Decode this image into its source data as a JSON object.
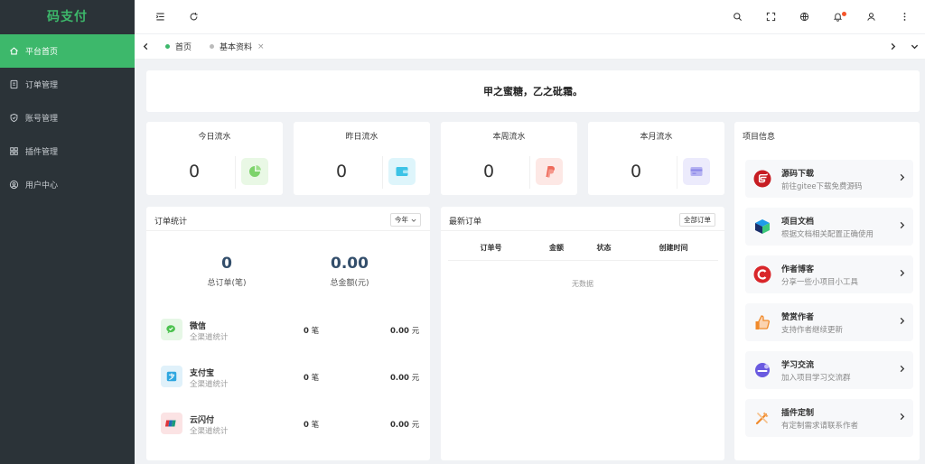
{
  "app": {
    "logo": "码支付"
  },
  "sidebar": {
    "items": [
      {
        "label": "平台首页",
        "icon": "home-icon"
      },
      {
        "label": "订单管理",
        "icon": "order-icon"
      },
      {
        "label": "账号管理",
        "icon": "shield-icon"
      },
      {
        "label": "插件管理",
        "icon": "grid-icon"
      },
      {
        "label": "用户中心",
        "icon": "user-circle-icon"
      }
    ]
  },
  "header": {
    "icons": [
      "menu-fold-icon",
      "refresh-icon",
      "search-icon",
      "fullscreen-icon",
      "globe-icon",
      "bell-icon",
      "user-icon",
      "more-icon"
    ]
  },
  "tabs": [
    {
      "label": "首页",
      "active": true
    },
    {
      "label": "基本资料",
      "active": false,
      "close": "×"
    }
  ],
  "banner": {
    "text": "甲之蜜糖，乙之砒霜。"
  },
  "stats": [
    {
      "title": "今日流水",
      "value": "0",
      "color": "#7dd36b",
      "bg": "#e9f8e5",
      "icon": "pie-chart-icon"
    },
    {
      "title": "昨日流水",
      "value": "0",
      "color": "#3cc3e6",
      "bg": "#def5fb",
      "icon": "wallet-icon"
    },
    {
      "title": "本周流水",
      "value": "0",
      "color": "#ef6a5a",
      "bg": "#fde8e5",
      "icon": "paypal-icon"
    },
    {
      "title": "本月流水",
      "value": "0",
      "color": "#8a86e8",
      "bg": "#ecebfc",
      "icon": "card-icon"
    }
  ],
  "orders_stats": {
    "title": "订单统计",
    "period": "今年",
    "total_orders": "0",
    "total_orders_label": "总订单(笔)",
    "total_amount": "0.00",
    "total_amount_label": "总金额(元)",
    "channels": [
      {
        "name": "微信",
        "sub": "全渠道统计",
        "count": "0",
        "count_unit": "笔",
        "amount": "0.00",
        "amount_unit": "元",
        "color": "#4cc24f",
        "bg": "#e6f7e6"
      },
      {
        "name": "支付宝",
        "sub": "全渠道统计",
        "count": "0",
        "count_unit": "笔",
        "amount": "0.00",
        "amount_unit": "元",
        "color": "#2fa7e0",
        "bg": "#e0f1fa"
      },
      {
        "name": "云闪付",
        "sub": "全渠道统计",
        "count": "0",
        "count_unit": "笔",
        "amount": "0.00",
        "amount_unit": "元",
        "color": "#e0353b",
        "bg": "#fbe3e4"
      }
    ]
  },
  "latest_orders": {
    "title": "最新订单",
    "button": "全部订单",
    "columns": [
      "订单号",
      "金额",
      "状态",
      "创建时间"
    ],
    "empty": "无数据"
  },
  "project": {
    "title": "项目信息",
    "items": [
      {
        "name": "源码下载",
        "desc": "前往gitee下载免费源码",
        "icon": "gitee-icon"
      },
      {
        "name": "项目文档",
        "desc": "根据文档相关配置正确使用",
        "icon": "doc-cube-icon"
      },
      {
        "name": "作者博客",
        "desc": "分享一些小项目小工具",
        "icon": "blog-icon"
      },
      {
        "name": "赞赏作者",
        "desc": "支持作者继续更新",
        "icon": "thumbs-up-icon"
      },
      {
        "name": "学习交流",
        "desc": "加入项目学习交流群",
        "icon": "chat-icon"
      },
      {
        "name": "插件定制",
        "desc": "有定制需求请联系作者",
        "icon": "tools-icon"
      }
    ]
  }
}
